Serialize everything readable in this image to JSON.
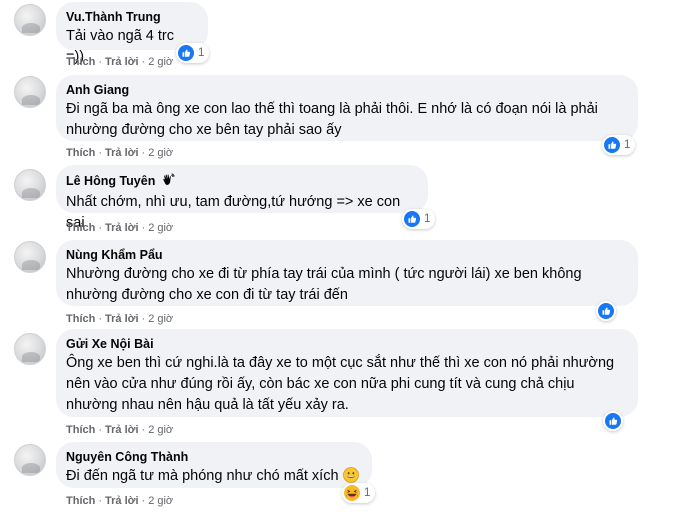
{
  "actions": {
    "like_label": "Thích",
    "reply_label": "Trả lời",
    "separator": "·"
  },
  "colors": {
    "like_blue": "#1877f2",
    "bubble_bg": "#f0f2f5",
    "meta_text": "#65676b"
  },
  "comments": [
    {
      "author": "Vu.Thành Trung",
      "text": "Tải vào ngã 4 trc =))",
      "time": "2 giờ",
      "reaction_icon": "like-icon",
      "reaction_count": "1"
    },
    {
      "author": "Anh Giang",
      "text": "Đi ngã ba mà ông xe con lao thế thì toang là phải thôi. E nhớ là có đoạn nói là phải nhường đường cho xe bên tay phải sao ấy",
      "time": "2 giờ",
      "reaction_icon": "like-icon",
      "reaction_count": "1"
    },
    {
      "author": "Lê Hông Tuyên",
      "author_badge": "waving-hand-icon",
      "text": "Nhất chớm, nhì ưu, tam đường,tứ hướng => xe con sai",
      "time": "2 giờ",
      "reaction_icon": "like-icon",
      "reaction_count": "1"
    },
    {
      "author": "Nùng Khẩm Pẩu",
      "text": "Nhường đường cho xe đi từ phía tay trái của mình ( tức người lái) xe ben không nhường đường cho xe con đi từ tay trái đến",
      "time": "2 giờ",
      "reaction_icon": "like-icon",
      "reaction_count": ""
    },
    {
      "author": "Gửi Xe Nội Bài",
      "text": "Ông xe ben thì cứ nghi.là ta đây xe to một cục sắt như thế thì xe con nó phải nhường nên vào cửa như đúng rồi ấy, còn bác xe con nữa phi cung tít và cung chả chịu nhường nhau nên hậu quả là tất yếu xảy ra.",
      "time": "2 giờ",
      "reaction_icon": "like-icon",
      "reaction_count": ""
    },
    {
      "author": "Nguyên Công Thành",
      "text": "Đi đến ngã tư mà phóng như chó mất xích",
      "inline_emoji": "grinning-face-emoji",
      "time": "2 giờ",
      "reaction_icon": "laughing-face-icon",
      "reaction_count": "1"
    }
  ]
}
